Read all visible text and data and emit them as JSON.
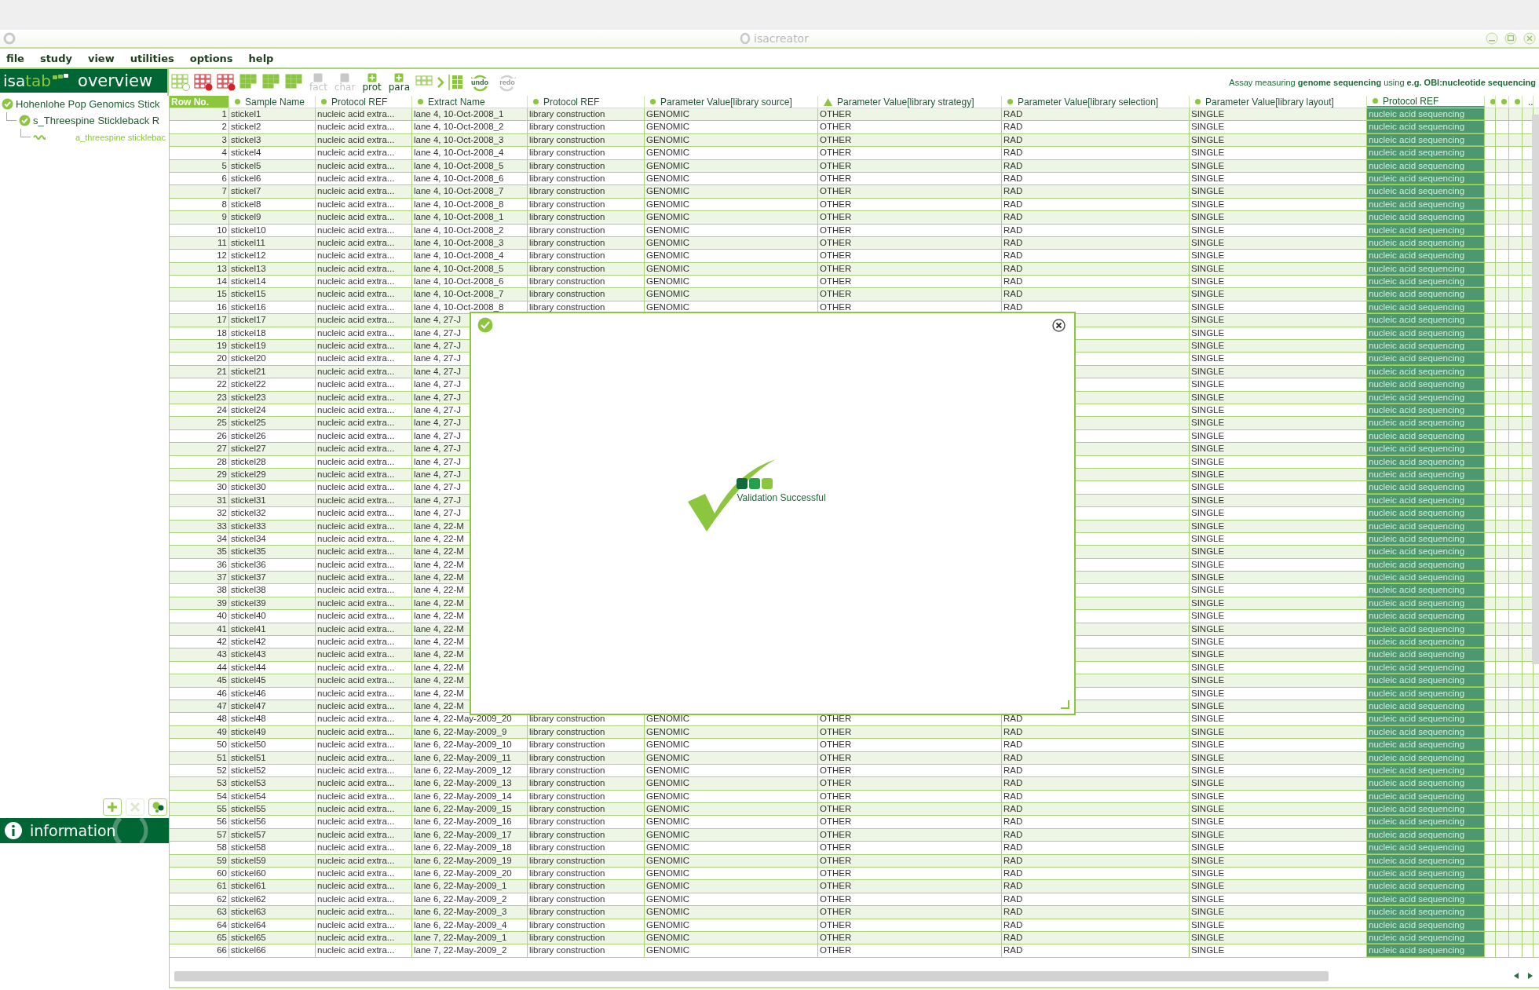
{
  "window": {
    "title": "isacreator"
  },
  "menu": [
    "file",
    "study",
    "view",
    "utilities",
    "options",
    "help"
  ],
  "sidebar": {
    "logo": [
      "isa",
      "tab"
    ],
    "heading": "overview",
    "tree": [
      {
        "label": "Hohenlohe Pop Genomics Stick",
        "kind": "investigation",
        "children": [
          {
            "label": "s_Threespine Stickleback R",
            "kind": "study",
            "children": [
              {
                "label": "a_threespine sticklebac",
                "kind": "assay"
              }
            ]
          }
        ]
      }
    ],
    "buttons": [
      {
        "kind": "add",
        "disabled": false
      },
      {
        "kind": "remove",
        "disabled": true
      },
      {
        "kind": "filter",
        "disabled": false
      }
    ],
    "info_label": "information"
  },
  "toolbar": {
    "buttons": [
      {
        "label": "fact",
        "disabled": true
      },
      {
        "label": "char",
        "disabled": true
      },
      {
        "label": "prot",
        "disabled": false
      },
      {
        "label": "para",
        "disabled": false
      }
    ],
    "history": [
      {
        "label": "undo",
        "disabled": false
      },
      {
        "label": "redo",
        "disabled": true
      }
    ],
    "assay_text": "Assay measuring **genome sequencing** using **e.g. OBI:nucleotide sequencing**"
  },
  "table": {
    "columns": [
      {
        "label": "Row No.",
        "kind": "index",
        "selected": false
      },
      {
        "label": "Sample Name",
        "kind": "dot",
        "selected": false
      },
      {
        "label": "Protocol REF",
        "kind": "dot",
        "selected": false
      },
      {
        "label": "Extract Name",
        "kind": "dot",
        "selected": false
      },
      {
        "label": "Protocol REF",
        "kind": "dot",
        "selected": false
      },
      {
        "label": "Parameter Value[library source]",
        "kind": "dot",
        "selected": false
      },
      {
        "label": "Parameter Value[library strategy]",
        "kind": "triangle",
        "selected": false
      },
      {
        "label": "Parameter Value[library selection]",
        "kind": "dot",
        "selected": false
      },
      {
        "label": "Parameter Value[library layout]",
        "kind": "dot",
        "selected": false
      },
      {
        "label": "Protocol REF",
        "kind": "dot",
        "selected": true
      },
      {
        "kind": "dot",
        "selected": false
      },
      {
        "kind": "dot",
        "selected": false
      },
      {
        "kind": "dot",
        "selected": false
      },
      {
        "label": "..",
        "kind": "plain",
        "selected": false
      }
    ],
    "rows": [
      {
        "cells": [
          "1",
          "stickel1",
          "nucleic acid extra...",
          "lane 4, 10-Oct-2008_1",
          "library construction",
          "GENOMIC",
          "OTHER",
          "RAD",
          "SINGLE",
          "nucleic acid sequencing"
        ]
      },
      {
        "cells": [
          "2",
          "stickel2",
          "nucleic acid extra...",
          "lane 4, 10-Oct-2008_2",
          "library construction",
          "GENOMIC",
          "OTHER",
          "RAD",
          "SINGLE",
          "nucleic acid sequencing"
        ]
      },
      {
        "cells": [
          "3",
          "stickel3",
          "nucleic acid extra...",
          "lane 4, 10-Oct-2008_3",
          "library construction",
          "GENOMIC",
          "OTHER",
          "RAD",
          "SINGLE",
          "nucleic acid sequencing"
        ]
      },
      {
        "cells": [
          "4",
          "stickel4",
          "nucleic acid extra...",
          "lane 4, 10-Oct-2008_4",
          "library construction",
          "GENOMIC",
          "OTHER",
          "RAD",
          "SINGLE",
          "nucleic acid sequencing"
        ]
      },
      {
        "cells": [
          "5",
          "stickel5",
          "nucleic acid extra...",
          "lane 4, 10-Oct-2008_5",
          "library construction",
          "GENOMIC",
          "OTHER",
          "RAD",
          "SINGLE",
          "nucleic acid sequencing"
        ]
      },
      {
        "cells": [
          "6",
          "stickel6",
          "nucleic acid extra...",
          "lane 4, 10-Oct-2008_6",
          "library construction",
          "GENOMIC",
          "OTHER",
          "RAD",
          "SINGLE",
          "nucleic acid sequencing"
        ]
      },
      {
        "cells": [
          "7",
          "stickel7",
          "nucleic acid extra...",
          "lane 4, 10-Oct-2008_7",
          "library construction",
          "GENOMIC",
          "OTHER",
          "RAD",
          "SINGLE",
          "nucleic acid sequencing"
        ]
      },
      {
        "cells": [
          "8",
          "stickel8",
          "nucleic acid extra...",
          "lane 4, 10-Oct-2008_8",
          "library construction",
          "GENOMIC",
          "OTHER",
          "RAD",
          "SINGLE",
          "nucleic acid sequencing"
        ]
      },
      {
        "cells": [
          "9",
          "stickel9",
          "nucleic acid extra...",
          "lane 4, 10-Oct-2008_1",
          "library construction",
          "GENOMIC",
          "OTHER",
          "RAD",
          "SINGLE",
          "nucleic acid sequencing"
        ]
      },
      {
        "cells": [
          "10",
          "stickel10",
          "nucleic acid extra...",
          "lane 4, 10-Oct-2008_2",
          "library construction",
          "GENOMIC",
          "OTHER",
          "RAD",
          "SINGLE",
          "nucleic acid sequencing"
        ]
      },
      {
        "cells": [
          "11",
          "stickel11",
          "nucleic acid extra...",
          "lane 4, 10-Oct-2008_3",
          "library construction",
          "GENOMIC",
          "OTHER",
          "RAD",
          "SINGLE",
          "nucleic acid sequencing"
        ]
      },
      {
        "cells": [
          "12",
          "stickel12",
          "nucleic acid extra...",
          "lane 4, 10-Oct-2008_4",
          "library construction",
          "GENOMIC",
          "OTHER",
          "RAD",
          "SINGLE",
          "nucleic acid sequencing"
        ]
      },
      {
        "cells": [
          "13",
          "stickel13",
          "nucleic acid extra...",
          "lane 4, 10-Oct-2008_5",
          "library construction",
          "GENOMIC",
          "OTHER",
          "RAD",
          "SINGLE",
          "nucleic acid sequencing"
        ]
      },
      {
        "cells": [
          "14",
          "stickel14",
          "nucleic acid extra...",
          "lane 4, 10-Oct-2008_6",
          "library construction",
          "GENOMIC",
          "OTHER",
          "RAD",
          "SINGLE",
          "nucleic acid sequencing"
        ]
      },
      {
        "cells": [
          "15",
          "stickel15",
          "nucleic acid extra...",
          "lane 4, 10-Oct-2008_7",
          "library construction",
          "GENOMIC",
          "OTHER",
          "RAD",
          "SINGLE",
          "nucleic acid sequencing"
        ]
      },
      {
        "cells": [
          "16",
          "stickel16",
          "nucleic acid extra...",
          "lane 4, 10-Oct-2008_8",
          "library construction",
          "GENOMIC",
          "OTHER",
          "RAD",
          "SINGLE",
          "nucleic acid sequencing"
        ]
      },
      {
        "cells": [
          "17",
          "stickel17",
          "nucleic acid extra...",
          "lane 4, 27-J"
        ],
        "tail": [
          "SINGLE",
          "nucleic acid sequencing"
        ]
      },
      {
        "cells": [
          "18",
          "stickel18",
          "nucleic acid extra...",
          "lane 4, 27-J"
        ],
        "tail": [
          "SINGLE",
          "nucleic acid sequencing"
        ]
      },
      {
        "cells": [
          "19",
          "stickel19",
          "nucleic acid extra...",
          "lane 4, 27-J"
        ],
        "tail": [
          "SINGLE",
          "nucleic acid sequencing"
        ]
      },
      {
        "cells": [
          "20",
          "stickel20",
          "nucleic acid extra...",
          "lane 4, 27-J"
        ],
        "tail": [
          "SINGLE",
          "nucleic acid sequencing"
        ]
      },
      {
        "cells": [
          "21",
          "stickel21",
          "nucleic acid extra...",
          "lane 4, 27-J"
        ],
        "tail": [
          "SINGLE",
          "nucleic acid sequencing"
        ]
      },
      {
        "cells": [
          "22",
          "stickel22",
          "nucleic acid extra...",
          "lane 4, 27-J"
        ],
        "tail": [
          "SINGLE",
          "nucleic acid sequencing"
        ]
      },
      {
        "cells": [
          "23",
          "stickel23",
          "nucleic acid extra...",
          "lane 4, 27-J"
        ],
        "tail": [
          "SINGLE",
          "nucleic acid sequencing"
        ]
      },
      {
        "cells": [
          "24",
          "stickel24",
          "nucleic acid extra...",
          "lane 4, 27-J"
        ],
        "tail": [
          "SINGLE",
          "nucleic acid sequencing"
        ]
      },
      {
        "cells": [
          "25",
          "stickel25",
          "nucleic acid extra...",
          "lane 4, 27-J"
        ],
        "tail": [
          "SINGLE",
          "nucleic acid sequencing"
        ]
      },
      {
        "cells": [
          "26",
          "stickel26",
          "nucleic acid extra...",
          "lane 4, 27-J"
        ],
        "tail": [
          "SINGLE",
          "nucleic acid sequencing"
        ]
      },
      {
        "cells": [
          "27",
          "stickel27",
          "nucleic acid extra...",
          "lane 4, 27-J"
        ],
        "tail": [
          "SINGLE",
          "nucleic acid sequencing"
        ]
      },
      {
        "cells": [
          "28",
          "stickel28",
          "nucleic acid extra...",
          "lane 4, 27-J"
        ],
        "tail": [
          "SINGLE",
          "nucleic acid sequencing"
        ]
      },
      {
        "cells": [
          "29",
          "stickel29",
          "nucleic acid extra...",
          "lane 4, 27-J"
        ],
        "tail": [
          "SINGLE",
          "nucleic acid sequencing"
        ]
      },
      {
        "cells": [
          "30",
          "stickel30",
          "nucleic acid extra...",
          "lane 4, 27-J"
        ],
        "tail": [
          "SINGLE",
          "nucleic acid sequencing"
        ]
      },
      {
        "cells": [
          "31",
          "stickel31",
          "nucleic acid extra...",
          "lane 4, 27-J"
        ],
        "tail": [
          "SINGLE",
          "nucleic acid sequencing"
        ]
      },
      {
        "cells": [
          "32",
          "stickel32",
          "nucleic acid extra...",
          "lane 4, 27-J"
        ],
        "tail": [
          "SINGLE",
          "nucleic acid sequencing"
        ]
      },
      {
        "cells": [
          "33",
          "stickel33",
          "nucleic acid extra...",
          "lane 4, 22-M"
        ],
        "tail": [
          "SINGLE",
          "nucleic acid sequencing"
        ]
      },
      {
        "cells": [
          "34",
          "stickel34",
          "nucleic acid extra...",
          "lane 4, 22-M"
        ],
        "tail": [
          "SINGLE",
          "nucleic acid sequencing"
        ]
      },
      {
        "cells": [
          "35",
          "stickel35",
          "nucleic acid extra...",
          "lane 4, 22-M"
        ],
        "tail": [
          "SINGLE",
          "nucleic acid sequencing"
        ]
      },
      {
        "cells": [
          "36",
          "stickel36",
          "nucleic acid extra...",
          "lane 4, 22-M"
        ],
        "tail": [
          "SINGLE",
          "nucleic acid sequencing"
        ]
      },
      {
        "cells": [
          "37",
          "stickel37",
          "nucleic acid extra...",
          "lane 4, 22-M"
        ],
        "tail": [
          "SINGLE",
          "nucleic acid sequencing"
        ]
      },
      {
        "cells": [
          "38",
          "stickel38",
          "nucleic acid extra...",
          "lane 4, 22-M"
        ],
        "tail": [
          "SINGLE",
          "nucleic acid sequencing"
        ]
      },
      {
        "cells": [
          "39",
          "stickel39",
          "nucleic acid extra...",
          "lane 4, 22-M"
        ],
        "tail": [
          "SINGLE",
          "nucleic acid sequencing"
        ]
      },
      {
        "cells": [
          "40",
          "stickel40",
          "nucleic acid extra...",
          "lane 4, 22-M"
        ],
        "tail": [
          "SINGLE",
          "nucleic acid sequencing"
        ]
      },
      {
        "cells": [
          "41",
          "stickel41",
          "nucleic acid extra...",
          "lane 4, 22-M"
        ],
        "tail": [
          "SINGLE",
          "nucleic acid sequencing"
        ]
      },
      {
        "cells": [
          "42",
          "stickel42",
          "nucleic acid extra...",
          "lane 4, 22-M"
        ],
        "tail": [
          "SINGLE",
          "nucleic acid sequencing"
        ]
      },
      {
        "cells": [
          "43",
          "stickel43",
          "nucleic acid extra...",
          "lane 4, 22-M"
        ],
        "tail": [
          "SINGLE",
          "nucleic acid sequencing"
        ]
      },
      {
        "cells": [
          "44",
          "stickel44",
          "nucleic acid extra...",
          "lane 4, 22-M"
        ],
        "tail": [
          "SINGLE",
          "nucleic acid sequencing"
        ]
      },
      {
        "cells": [
          "45",
          "stickel45",
          "nucleic acid extra...",
          "lane 4, 22-M"
        ],
        "tail": [
          "SINGLE",
          "nucleic acid sequencing"
        ]
      },
      {
        "cells": [
          "46",
          "stickel46",
          "nucleic acid extra...",
          "lane 4, 22-M"
        ],
        "tail": [
          "SINGLE",
          "nucleic acid sequencing"
        ]
      },
      {
        "cells": [
          "47",
          "stickel47",
          "nucleic acid extra...",
          "lane 4, 22-M"
        ],
        "tail": [
          "SINGLE",
          "nucleic acid sequencing"
        ]
      },
      {
        "cells": [
          "48",
          "stickel48",
          "nucleic acid extra...",
          "lane 4, 22-May-2009_20",
          "library construction",
          "GENOMIC",
          "OTHER",
          "RAD",
          "SINGLE",
          "nucleic acid sequencing"
        ]
      },
      {
        "cells": [
          "49",
          "stickel49",
          "nucleic acid extra...",
          "lane 6, 22-May-2009_9",
          "library construction",
          "GENOMIC",
          "OTHER",
          "RAD",
          "SINGLE",
          "nucleic acid sequencing"
        ]
      },
      {
        "cells": [
          "50",
          "stickel50",
          "nucleic acid extra...",
          "lane 6, 22-May-2009_10",
          "library construction",
          "GENOMIC",
          "OTHER",
          "RAD",
          "SINGLE",
          "nucleic acid sequencing"
        ]
      },
      {
        "cells": [
          "51",
          "stickel51",
          "nucleic acid extra...",
          "lane 6, 22-May-2009_11",
          "library construction",
          "GENOMIC",
          "OTHER",
          "RAD",
          "SINGLE",
          "nucleic acid sequencing"
        ]
      },
      {
        "cells": [
          "52",
          "stickel52",
          "nucleic acid extra...",
          "lane 6, 22-May-2009_12",
          "library construction",
          "GENOMIC",
          "OTHER",
          "RAD",
          "SINGLE",
          "nucleic acid sequencing"
        ]
      },
      {
        "cells": [
          "53",
          "stickel53",
          "nucleic acid extra...",
          "lane 6, 22-May-2009_13",
          "library construction",
          "GENOMIC",
          "OTHER",
          "RAD",
          "SINGLE",
          "nucleic acid sequencing"
        ]
      },
      {
        "cells": [
          "54",
          "stickel54",
          "nucleic acid extra...",
          "lane 6, 22-May-2009_14",
          "library construction",
          "GENOMIC",
          "OTHER",
          "RAD",
          "SINGLE",
          "nucleic acid sequencing"
        ]
      },
      {
        "cells": [
          "55",
          "stickel55",
          "nucleic acid extra...",
          "lane 6, 22-May-2009_15",
          "library construction",
          "GENOMIC",
          "OTHER",
          "RAD",
          "SINGLE",
          "nucleic acid sequencing"
        ]
      },
      {
        "cells": [
          "56",
          "stickel56",
          "nucleic acid extra...",
          "lane 6, 22-May-2009_16",
          "library construction",
          "GENOMIC",
          "OTHER",
          "RAD",
          "SINGLE",
          "nucleic acid sequencing"
        ]
      },
      {
        "cells": [
          "57",
          "stickel57",
          "nucleic acid extra...",
          "lane 6, 22-May-2009_17",
          "library construction",
          "GENOMIC",
          "OTHER",
          "RAD",
          "SINGLE",
          "nucleic acid sequencing"
        ]
      },
      {
        "cells": [
          "58",
          "stickel58",
          "nucleic acid extra...",
          "lane 6, 22-May-2009_18",
          "library construction",
          "GENOMIC",
          "OTHER",
          "RAD",
          "SINGLE",
          "nucleic acid sequencing"
        ]
      },
      {
        "cells": [
          "59",
          "stickel59",
          "nucleic acid extra...",
          "lane 6, 22-May-2009_19",
          "library construction",
          "GENOMIC",
          "OTHER",
          "RAD",
          "SINGLE",
          "nucleic acid sequencing"
        ]
      },
      {
        "cells": [
          "60",
          "stickel60",
          "nucleic acid extra...",
          "lane 6, 22-May-2009_20",
          "library construction",
          "GENOMIC",
          "OTHER",
          "RAD",
          "SINGLE",
          "nucleic acid sequencing"
        ]
      },
      {
        "cells": [
          "61",
          "stickel61",
          "nucleic acid extra...",
          "lane 6, 22-May-2009_1",
          "library construction",
          "GENOMIC",
          "OTHER",
          "RAD",
          "SINGLE",
          "nucleic acid sequencing"
        ]
      },
      {
        "cells": [
          "62",
          "stickel62",
          "nucleic acid extra...",
          "lane 6, 22-May-2009_2",
          "library construction",
          "GENOMIC",
          "OTHER",
          "RAD",
          "SINGLE",
          "nucleic acid sequencing"
        ]
      },
      {
        "cells": [
          "63",
          "stickel63",
          "nucleic acid extra...",
          "lane 6, 22-May-2009_3",
          "library construction",
          "GENOMIC",
          "OTHER",
          "RAD",
          "SINGLE",
          "nucleic acid sequencing"
        ]
      },
      {
        "cells": [
          "64",
          "stickel64",
          "nucleic acid extra...",
          "lane 6, 22-May-2009_4",
          "library construction",
          "GENOMIC",
          "OTHER",
          "RAD",
          "SINGLE",
          "nucleic acid sequencing"
        ]
      },
      {
        "cells": [
          "65",
          "stickel65",
          "nucleic acid extra...",
          "lane 7, 22-May-2009_1",
          "library construction",
          "GENOMIC",
          "OTHER",
          "RAD",
          "SINGLE",
          "nucleic acid sequencing"
        ]
      },
      {
        "cells": [
          "66",
          "stickel66",
          "nucleic acid extra...",
          "lane 7, 22-May-2009_2",
          "library construction",
          "GENOMIC",
          "OTHER",
          "RAD",
          "SINGLE",
          "nucleic acid sequencing"
        ]
      }
    ]
  },
  "dialog": {
    "message": "Validation Successful"
  }
}
